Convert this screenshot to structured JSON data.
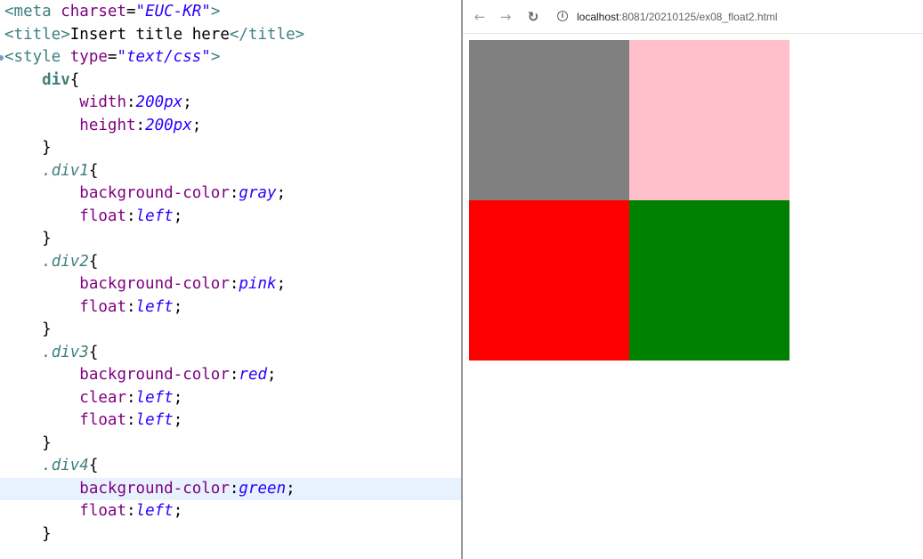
{
  "editor": {
    "lines": [
      [
        [
          "c-tag",
          "<meta "
        ],
        [
          "c-attr",
          "charset"
        ],
        [
          "c-pun",
          "="
        ],
        [
          "c-str",
          "\"EUC-KR\""
        ],
        [
          "c-tag",
          ">"
        ]
      ],
      [
        [
          "c-tag",
          "<title>"
        ],
        [
          "c-pun",
          "Insert title here"
        ],
        [
          "c-tag",
          "</title>"
        ]
      ],
      [
        [
          "c-tag",
          "<style "
        ],
        [
          "c-attr",
          "type"
        ],
        [
          "c-pun",
          "="
        ],
        [
          "c-str",
          "\"text/css\""
        ],
        [
          "c-tag",
          ">"
        ]
      ],
      [
        [
          "c-pun",
          "    "
        ],
        [
          "c-sel",
          "div"
        ],
        [
          "c-pun",
          "{"
        ]
      ],
      [
        [
          "c-pun",
          "        "
        ],
        [
          "c-prop",
          "width"
        ],
        [
          "c-pun",
          ":"
        ],
        [
          "c-val",
          "200px"
        ],
        [
          "c-pun",
          ";"
        ]
      ],
      [
        [
          "c-pun",
          "        "
        ],
        [
          "c-prop",
          "height"
        ],
        [
          "c-pun",
          ":"
        ],
        [
          "c-val",
          "200px"
        ],
        [
          "c-pun",
          ";"
        ]
      ],
      [
        [
          "c-pun",
          "    }"
        ]
      ],
      [
        [
          "c-pun",
          "    "
        ],
        [
          "c-cls",
          ".div1"
        ],
        [
          "c-pun",
          "{"
        ]
      ],
      [
        [
          "c-pun",
          "        "
        ],
        [
          "c-prop",
          "background-color"
        ],
        [
          "c-pun",
          ":"
        ],
        [
          "c-val",
          "gray"
        ],
        [
          "c-pun",
          ";"
        ]
      ],
      [
        [
          "c-pun",
          "        "
        ],
        [
          "c-prop",
          "float"
        ],
        [
          "c-pun",
          ":"
        ],
        [
          "c-val",
          "left"
        ],
        [
          "c-pun",
          ";"
        ]
      ],
      [
        [
          "c-pun",
          "    }"
        ]
      ],
      [
        [
          "c-pun",
          "    "
        ],
        [
          "c-cls",
          ".div2"
        ],
        [
          "c-pun",
          "{"
        ]
      ],
      [
        [
          "c-pun",
          "        "
        ],
        [
          "c-prop",
          "background-color"
        ],
        [
          "c-pun",
          ":"
        ],
        [
          "c-val",
          "pink"
        ],
        [
          "c-pun",
          ";"
        ]
      ],
      [
        [
          "c-pun",
          "        "
        ],
        [
          "c-prop",
          "float"
        ],
        [
          "c-pun",
          ":"
        ],
        [
          "c-val",
          "left"
        ],
        [
          "c-pun",
          ";"
        ]
      ],
      [
        [
          "c-pun",
          "    }"
        ]
      ],
      [
        [
          "c-pun",
          "    "
        ],
        [
          "c-cls",
          ".div3"
        ],
        [
          "c-pun",
          "{"
        ]
      ],
      [
        [
          "c-pun",
          "        "
        ],
        [
          "c-prop",
          "background-color"
        ],
        [
          "c-pun",
          ":"
        ],
        [
          "c-val",
          "red"
        ],
        [
          "c-pun",
          ";"
        ]
      ],
      [
        [
          "c-pun",
          "        "
        ],
        [
          "c-prop",
          "clear"
        ],
        [
          "c-pun",
          ":"
        ],
        [
          "c-val",
          "left"
        ],
        [
          "c-pun",
          ";"
        ]
      ],
      [
        [
          "c-pun",
          "        "
        ],
        [
          "c-prop",
          "float"
        ],
        [
          "c-pun",
          ":"
        ],
        [
          "c-val",
          "left"
        ],
        [
          "c-pun",
          ";"
        ]
      ],
      [
        [
          "c-pun",
          "    }"
        ]
      ],
      [
        [
          "c-pun",
          "    "
        ],
        [
          "c-cls",
          ".div4"
        ],
        [
          "c-pun",
          "{"
        ]
      ],
      [
        [
          "c-pun",
          "        "
        ],
        [
          "c-prop",
          "background-color"
        ],
        [
          "c-pun",
          ":"
        ],
        [
          "c-val",
          "green"
        ],
        [
          "c-pun",
          ";"
        ]
      ],
      [
        [
          "c-pun",
          "        "
        ],
        [
          "c-prop",
          "float"
        ],
        [
          "c-pun",
          ":"
        ],
        [
          "c-val",
          "left"
        ],
        [
          "c-pun",
          ";"
        ]
      ],
      [
        [
          "c-pun",
          "    }"
        ]
      ]
    ],
    "highlighted_line": 21,
    "fold_marker_line": 2
  },
  "browser": {
    "back_icon": "arrow-left-icon",
    "forward_icon": "arrow-right-icon",
    "reload_icon": "reload-icon",
    "info_icon": "info-icon",
    "url_host": "localhost",
    "url_rest": ":8081/20210125/ex08_float2.html"
  },
  "page": {
    "boxes": [
      {
        "name": "div1-gray-box",
        "color": "#808080"
      },
      {
        "name": "div2-pink-box",
        "color": "#ffc0cb"
      },
      {
        "name": "div3-red-box",
        "color": "#ff0000"
      },
      {
        "name": "div4-green-box",
        "color": "#008000"
      }
    ]
  }
}
